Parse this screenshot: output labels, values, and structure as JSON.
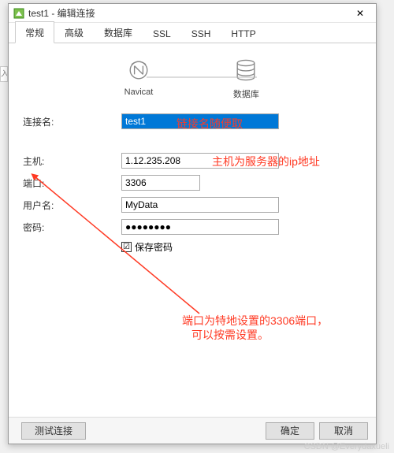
{
  "window": {
    "title": "test1 - 编辑连接",
    "close_glyph": "✕"
  },
  "tabs": [
    "常规",
    "高级",
    "数据库",
    "SSL",
    "SSH",
    "HTTP"
  ],
  "header": {
    "left_label": "Navicat",
    "right_label": "数据库"
  },
  "form": {
    "conn_name_label": "连接名:",
    "conn_name_value": "test1",
    "host_label": "主机:",
    "host_value": "1.12.235.208",
    "port_label": "端口:",
    "port_value": "3306",
    "user_label": "用户名:",
    "user_value": "MyData",
    "password_label": "密码:",
    "password_value": "●●●●●●●●",
    "save_pw_label": "保存密码",
    "save_pw_checked": "☑"
  },
  "footer": {
    "test_label": "测试连接",
    "ok_label": "确定",
    "cancel_label": "取消"
  },
  "annotations": {
    "conn_name": "链接名随便取",
    "host": "主机为服务器的ip地址",
    "port_line1": "端口为特地设置的3306端口，",
    "port_line2": "可以按需设置。"
  },
  "watermark": "CSDN @Everydaxueli",
  "bg_hint": "入闻"
}
